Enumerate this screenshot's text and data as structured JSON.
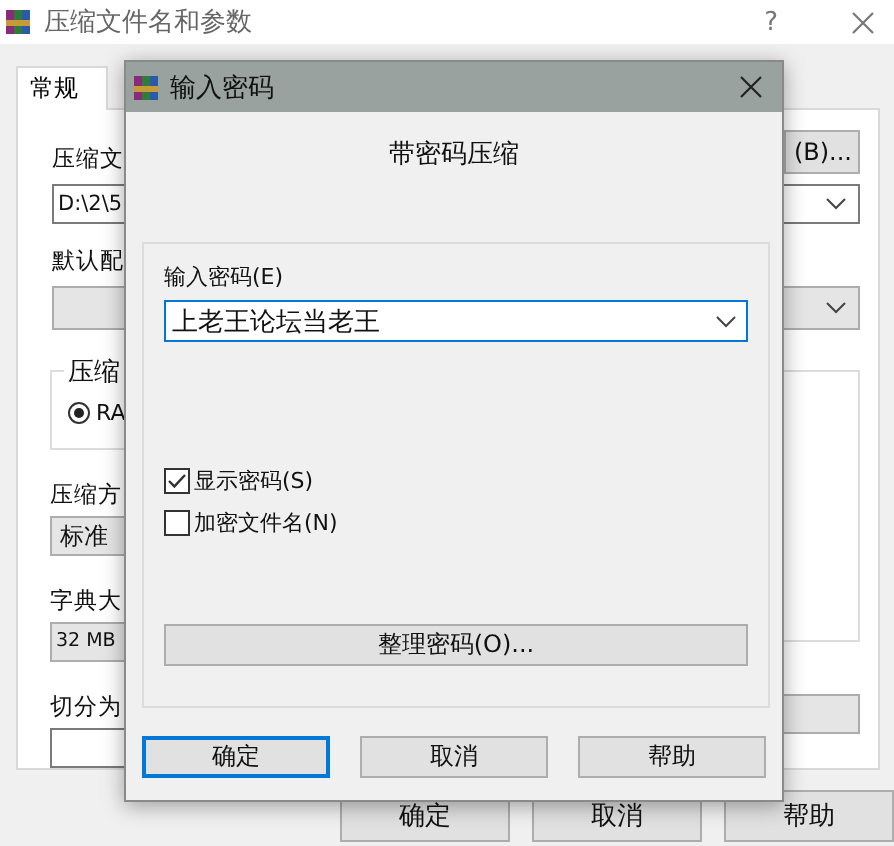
{
  "main_window": {
    "title": "压缩文件名和参数",
    "help_button": "?",
    "tabs": [
      {
        "label": "常规",
        "selected": true
      }
    ],
    "archive_name_label": "压缩文",
    "archive_name_value": "D:\\2\\5",
    "browse_button": "(B)...",
    "default_profile_label": "默认配",
    "format_group_label": "压缩",
    "format_options": [
      {
        "label": "RA",
        "selected": true
      }
    ],
    "method_label": "压缩方",
    "method_value": "标准",
    "dictionary_label": "字典大",
    "dictionary_value": "32 MB",
    "split_label": "切分为",
    "buttons": [
      "确定",
      "取消",
      "帮助"
    ]
  },
  "dialog": {
    "title": "输入密码",
    "heading": "带密码压缩",
    "password_label": "输入密码(E)",
    "password_value": "上老王论坛当老王",
    "checkboxes": [
      {
        "label": "显示密码(S)",
        "checked": true
      },
      {
        "label": "加密文件名(N)",
        "checked": false
      }
    ],
    "organize_button": "整理密码(O)...",
    "buttons": [
      {
        "label": "确定",
        "default": true
      },
      {
        "label": "取消",
        "default": false
      },
      {
        "label": "帮助",
        "default": false
      }
    ]
  }
}
